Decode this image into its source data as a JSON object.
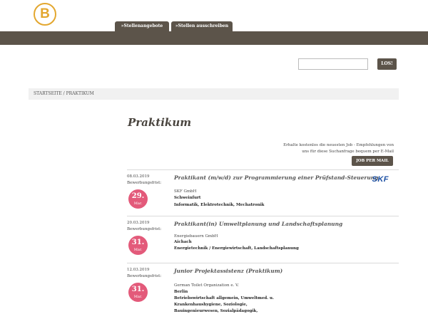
{
  "logo": {
    "letter": "B",
    "color": "#e3a72f"
  },
  "nav": {
    "tabs": [
      {
        "label": "»Stellenangebote"
      },
      {
        "label": "»Stellen ausschreiben"
      }
    ]
  },
  "search": {
    "placeholder": "",
    "button_label": "LOS!"
  },
  "breadcrumb": {
    "text": "STARTSEITE  /  PRAKTIKUM"
  },
  "page": {
    "title": "Praktikum"
  },
  "alert": {
    "line1": "Erhalte kostenlos die neuesten Job - Empfehlungen von",
    "line2": "uns für diese Suchanfrage bequem per E-Mail",
    "button_label": "JOB PER MAIL"
  },
  "jobs": [
    {
      "date": "08.03.2019",
      "deadline_label": "Bewerbungsfrist:",
      "deadline_day": "29.",
      "deadline_month": "Mar.",
      "title": "Praktikant (m/w/d) zur Programmierung einer Prüfstand-Steuerung",
      "company": "SKF GmbH",
      "location": "Schweinfurt",
      "field": "Informatik, Elektrotechnik, Mechatronik",
      "company_logo": "SKF"
    },
    {
      "date": "20.03.2019",
      "deadline_label": "Bewerbungsfrist:",
      "deadline_day": "31.",
      "deadline_month": "Mar.",
      "title": "Praktikant(in) Umweltplanung und Landschaftsplanung",
      "company": "Energiebauern GmbH",
      "location": "Aichach",
      "field": "Energietechnik / Energiewirtschaft, Landschaftsplanung"
    },
    {
      "date": "12.03.2019",
      "deadline_label": "Bewerbungsfrist:",
      "deadline_day": "31.",
      "deadline_month": "Mar.",
      "title": "Junior Projektassistenz (Praktikum)",
      "company": "German Toilet Organization e. V.",
      "location": "Berlin",
      "field": "Betriebswirtschaft allgemein, Umweltmed. u. Krankenhaushygiene, Soziologie, Bauingenieurwesen, Sozialpädagogik, Erziehungswissenschaft,"
    }
  ],
  "colors": {
    "brand_brown": "#5c544a",
    "deadline_pink": "#e35a7a",
    "skf_blue": "#1b4fa3"
  }
}
